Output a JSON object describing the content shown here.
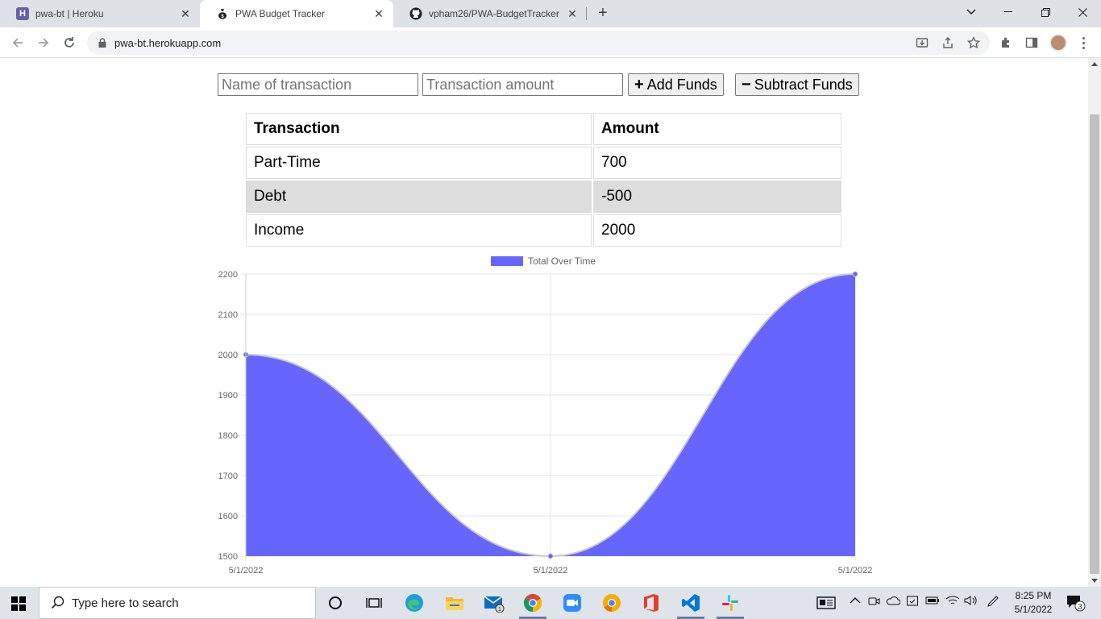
{
  "browser": {
    "tabs": [
      {
        "title": "pwa-bt | Heroku",
        "icon": "heroku-icon",
        "active": false
      },
      {
        "title": "PWA Budget Tracker",
        "icon": "money-bag-icon",
        "active": true
      },
      {
        "title": "vpham26/PWA-BudgetTracker",
        "icon": "github-icon",
        "active": false
      }
    ],
    "url": "pwa-bt.herokuapp.com"
  },
  "form": {
    "name_placeholder": "Name of transaction",
    "amount_placeholder": "Transaction amount",
    "add_label": "Add Funds",
    "subtract_label": "Subtract Funds",
    "add_icon": "+",
    "subtract_icon": "−"
  },
  "table": {
    "headers": [
      "Transaction",
      "Amount"
    ],
    "rows": [
      {
        "name": "Part-Time",
        "amount": "700"
      },
      {
        "name": "Debt",
        "amount": "-500"
      },
      {
        "name": "Income",
        "amount": "2000"
      }
    ]
  },
  "chart_data": {
    "type": "area",
    "x": [
      "5/1/2022",
      "5/1/2022",
      "5/1/2022"
    ],
    "series": [
      {
        "name": "Total Over Time",
        "values": [
          2000,
          1500,
          2200
        ],
        "color": "#6666ff"
      }
    ],
    "ylim": [
      1500,
      2200
    ],
    "yticks": [
      1500,
      1600,
      1700,
      1800,
      1900,
      2000,
      2100,
      2200
    ],
    "grid": true,
    "legend": "top-center"
  },
  "taskbar": {
    "search_placeholder": "Type here to search",
    "time": "8:25 PM",
    "date": "5/1/2022",
    "notification_count": "3",
    "mail_badge": "1"
  }
}
